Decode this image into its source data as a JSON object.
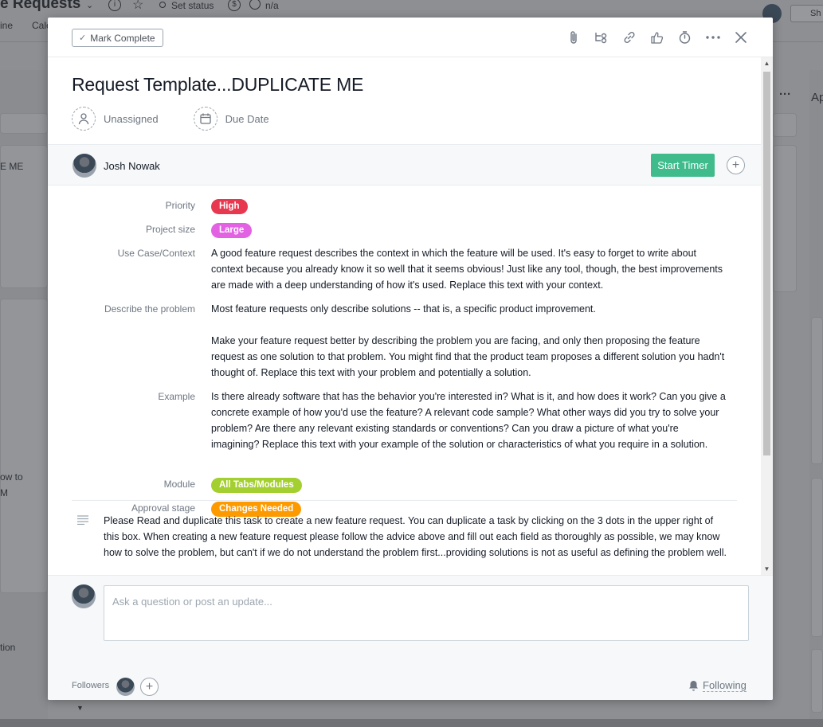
{
  "background": {
    "project_title": "e Requests",
    "set_status": "Set status",
    "na": "n/a",
    "tabs": [
      "ine",
      "Cale"
    ],
    "share": "Sh",
    "right_col_header": "Ap",
    "left_snippets": [
      "E ME",
      "ow to",
      "M",
      "tion"
    ]
  },
  "header": {
    "mark_complete_label": "Mark Complete",
    "icons": [
      "attachment-icon",
      "subtask-icon",
      "link-icon",
      "like-icon",
      "timer-icon",
      "more-icon",
      "close-icon"
    ]
  },
  "task": {
    "title": "Request Template...DUPLICATE ME",
    "assignee": "Unassigned",
    "due_date": "Due Date"
  },
  "owner": {
    "name": "Josh Nowak",
    "start_timer_label": "Start Timer"
  },
  "fields": {
    "priority": {
      "label": "Priority",
      "value": "High",
      "color": "#e8384f"
    },
    "project_size": {
      "label": "Project size",
      "value": "Large",
      "color": "#e362e3"
    },
    "use_case": {
      "label": "Use Case/Context",
      "value": "A good feature request describes the context in which the feature will be used. It's easy to forget to write about context because you already know it so well that it seems obvious! Just like any tool, though, the best improvements are made with a deep understanding of how it's used. Replace this text with your context."
    },
    "problem": {
      "label": "Describe the problem",
      "value_1": "Most feature requests only describe solutions -- that is, a specific product improvement.",
      "value_2": "Make your feature request better by describing the problem you are facing, and only then proposing the feature request as one solution to that problem. You might find that the product team proposes a different solution you hadn't thought of.  Replace this text with your problem and potentially a solution."
    },
    "example": {
      "label": "Example",
      "value": "Is there already software that has the behavior you're interested in? What is it, and how does it work? Can you give a concrete example of how you'd use the feature? A relevant code sample? What other ways did you try to solve your problem? Are there any relevant existing standards or conventions? Can you draw a picture of what you're imagining?  Replace this text with your example of the solution or characteristics of what you require in a solution."
    },
    "module": {
      "label": "Module",
      "value": "All Tabs/Modules",
      "color": "#a4cf30"
    },
    "approval_stage": {
      "label": "Approval stage",
      "value": "Changes Needed",
      "color": "#fd9a00"
    }
  },
  "description": "Please Read and duplicate this task to create a new feature request. You can duplicate a task by clicking on the 3 dots in the upper right of this box. When creating a new feature request please follow the advice above and fill out each field as thoroughly as possible, we may know how to solve the problem, but can't if we do not understand the problem first...providing solutions is not as useful as defining the problem well.",
  "comment": {
    "placeholder": "Ask a question or post an update..."
  },
  "footer": {
    "followers_label": "Followers",
    "following_label": "Following"
  }
}
